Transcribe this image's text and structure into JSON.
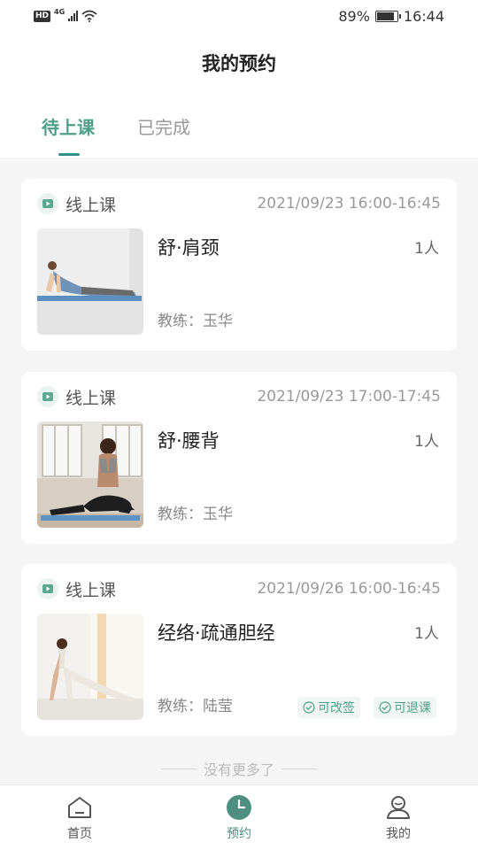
{
  "status_bar": {
    "hd": "HD",
    "network": "4G",
    "battery_percent": "89%",
    "time": "16:44"
  },
  "header": {
    "title": "我的预约"
  },
  "tabs": [
    {
      "label": "待上课",
      "active": true
    },
    {
      "label": "已完成",
      "active": false
    }
  ],
  "appointments": [
    {
      "type": "线上课",
      "time": "2021/09/23 16:00-16:45",
      "course": "舒·肩颈",
      "people": "1人",
      "coach": "教练：玉华",
      "tags": []
    },
    {
      "type": "线上课",
      "time": "2021/09/23 17:00-17:45",
      "course": "舒·腰背",
      "people": "1人",
      "coach": "教练：玉华",
      "tags": []
    },
    {
      "type": "线上课",
      "time": "2021/09/26 16:00-16:45",
      "course": "经络·疏通胆经",
      "people": "1人",
      "coach": "教练：陆莹",
      "tags": [
        "可改签",
        "可退课"
      ]
    }
  ],
  "list_end_hint": "没有更多了",
  "bottom_nav": [
    {
      "label": "首页",
      "icon": "home-icon",
      "active": false
    },
    {
      "label": "预约",
      "icon": "clock-icon",
      "active": true
    },
    {
      "label": "我的",
      "icon": "profile-icon",
      "active": false
    }
  ],
  "colors": {
    "accent": "#4f9f88",
    "indicator": "#2f8f85",
    "background": "#f5f5f5"
  }
}
